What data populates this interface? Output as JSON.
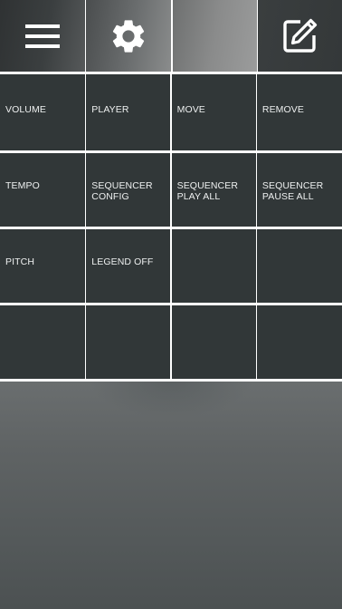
{
  "toolbar": {
    "buttons": [
      {
        "icon": "hamburger-menu-icon"
      },
      {
        "icon": "gear-icon"
      },
      {
        "icon": ""
      },
      {
        "icon": "edit-icon"
      }
    ]
  },
  "grid": {
    "cells": [
      "VOLUME",
      "PLAYER",
      "MOVE",
      "REMOVE",
      "TEMPO",
      "SEQUENCER\nCONFIG",
      "SEQUENCER\nPLAY ALL",
      "SEQUENCER\nPAUSE ALL",
      "PITCH",
      "LEGEND OFF",
      "",
      "",
      "",
      "",
      "",
      ""
    ]
  },
  "colors": {
    "cell_background": "#313738",
    "cell_text": "#eef0f0",
    "divider": "#ffffff"
  }
}
